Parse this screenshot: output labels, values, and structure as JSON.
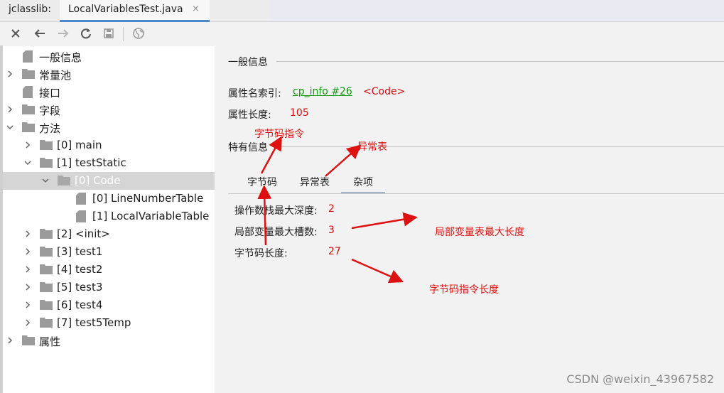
{
  "tabbar": {
    "app_label": "jclasslib:",
    "active_tab": "LocalVariablesTest.java",
    "close_glyph": "×"
  },
  "toolbar": {
    "buttons": [
      "close-icon",
      "back-arrow-icon",
      "forward-arrow-icon",
      "refresh-icon",
      "save-icon",
      "web-icon"
    ]
  },
  "tree": {
    "general": "一般信息",
    "constant_pool": "常量池",
    "interfaces": "接口",
    "fields": "字段",
    "methods": "方法",
    "m0": "[0] main",
    "m1": "[1] testStatic",
    "code": "[0] Code",
    "lnt": "[0] LineNumberTable",
    "lvt": "[1] LocalVariableTable",
    "m2": "[2] <init>",
    "m3": "[3] test1",
    "m4": "[4] test2",
    "m5": "[5] test3",
    "m6": "[6] test4",
    "m7": "[7] test5Temp",
    "attributes": "属性"
  },
  "panel": {
    "general_title": "一般信息",
    "attr_name_index_label": "属性名索引:",
    "attr_name_index_link": "cp_info #26",
    "attr_name_index_value": "<Code>",
    "attr_length_label": "属性长度:",
    "attr_length_value": "105",
    "specific_title": "特有信息",
    "subtabs": [
      "字节码",
      "异常表",
      "杂项"
    ],
    "max_stack_label": "操作数栈最大深度:",
    "max_stack_value": "2",
    "max_locals_label": "局部变量最大槽数:",
    "max_locals_value": "3",
    "code_length_label": "字节码长度:",
    "code_length_value": "27"
  },
  "annotations": {
    "bytecode_instructions": "字节码指令",
    "exception_table": "异常表",
    "max_locals_note": "局部变量表最大长度",
    "code_length_note": "字节码指令长度"
  },
  "watermark": "CSDN @weixin_43967582",
  "colors": {
    "link_green": "#119911",
    "value_red": "#cc1111",
    "annotation_red": "#dd1111",
    "selected_row": "#d5d5d5",
    "tab_underline": "#4a88c7"
  }
}
